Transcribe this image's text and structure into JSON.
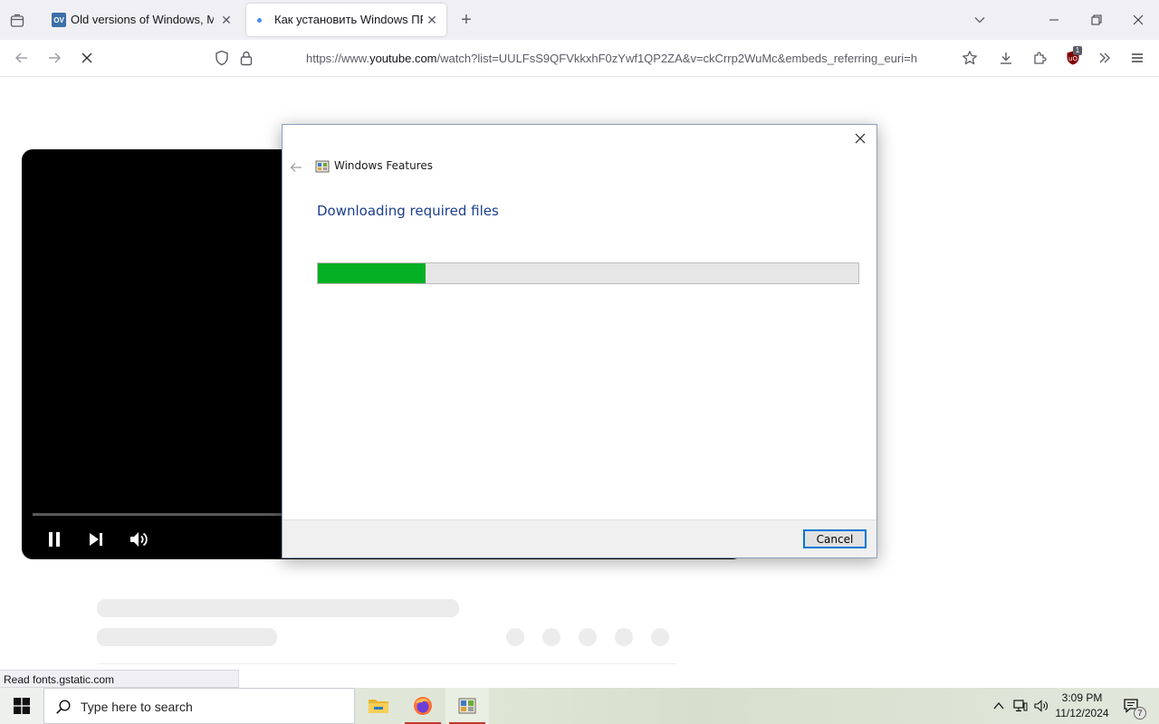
{
  "browser": {
    "tabs": [
      {
        "favicon": "OV",
        "title": "Old versions of Windows, Mac"
      },
      {
        "title": "Как установить Windows ПРАВ"
      }
    ],
    "url": {
      "prefix": "https://www.",
      "domain": "youtube.com",
      "rest": "/watch?list=UULFsS9QFVkkxhF0zYwf1QP2ZA&v=ckCrrp2WuMc&embeds_referring_euri=h"
    },
    "extension_badge": "1",
    "status_text": "Read fonts.gstatic.com"
  },
  "dialog": {
    "title": "Windows Features",
    "heading": "Downloading required files",
    "progress_fraction": 0.2,
    "cancel_label": "Cancel"
  },
  "taskbar": {
    "search_placeholder": "Type here to search",
    "time": "3:09 PM",
    "date": "11/12/2024",
    "notification_count": "7"
  },
  "colors": {
    "progress_fill": "#06b025",
    "dialog_heading": "#1b3f8b",
    "cancel_border": "#0078d7"
  }
}
